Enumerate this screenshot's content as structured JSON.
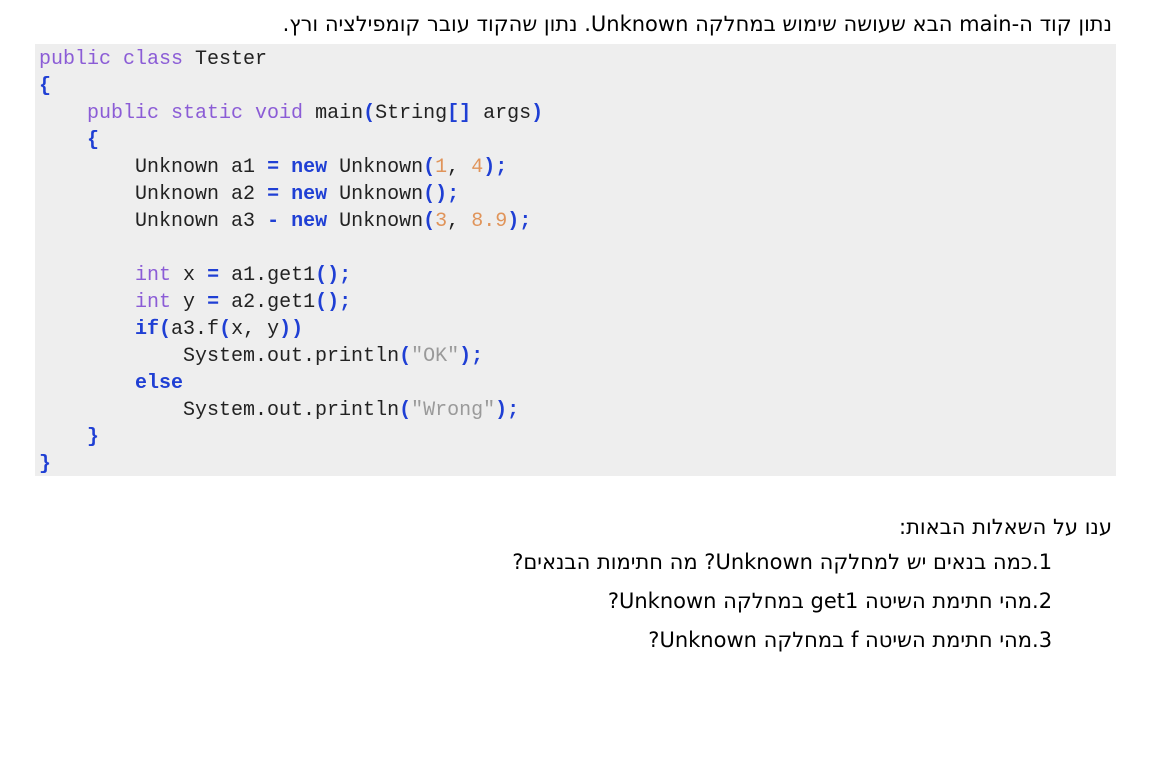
{
  "intro_text": "נתון קוד ה-main הבא שעושה שימוש במחלקה Unknown. נתון שהקוד עובר קומפילציה ורץ.",
  "code": {
    "class_keyword": "public class",
    "class_name": "Tester",
    "open_brace": "{",
    "close_brace": "}",
    "main_modifiers": "public static void",
    "main_signature_name": "main",
    "main_param_type": "String",
    "main_param_array": "[]",
    "main_param_name": "args",
    "line_a1_prefix": "Unknown a1",
    "line_a1_op": "=",
    "line_a1_ctor": "Unknown",
    "line_a1_arg1": "1",
    "line_a1_arg2": "4",
    "line_a2_prefix": "Unknown a2",
    "line_a2_op": "=",
    "line_a2_ctor": "Unknown",
    "line_a3_prefix": "Unknown a3",
    "line_a3_op": "-",
    "line_a3_ctor": "Unknown",
    "line_a3_arg1": "3",
    "line_a3_arg2": "8.9",
    "new_keyword": "new",
    "int_keyword": "int",
    "line_x_name": "x",
    "line_x_call": "a1.get1",
    "line_y_name": "y",
    "line_y_call": "a2.get1",
    "if_keyword": "if",
    "if_call": "a3.f",
    "if_args": "x, y",
    "println_call": "System.out.println",
    "ok_string": "\"OK\"",
    "else_keyword": "else",
    "wrong_string": "\"Wrong\""
  },
  "questions_heading": "ענו על השאלות הבאות:",
  "questions": [
    {
      "num": "1.",
      "text": "כמה בנאים יש למחלקה Unknown? מה חתימות הבנאים?"
    },
    {
      "num": "2.",
      "text": "מהי חתימת השיטה get1 במחלקה Unknown?"
    },
    {
      "num": "3.",
      "text": "מהי חתימת השיטה f במחלקה Unknown?"
    }
  ]
}
